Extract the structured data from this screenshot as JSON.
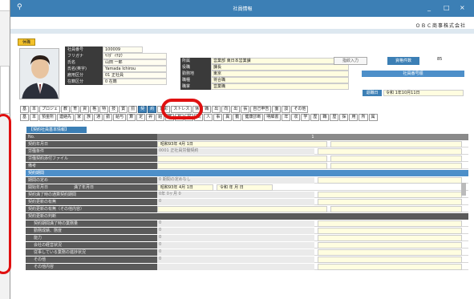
{
  "window": {
    "title": "社員情報",
    "company": "ＯＢＣ商事株式会社",
    "min": "_",
    "max": "□",
    "close": "×"
  },
  "badge": "休職",
  "employee": {
    "fields": [
      {
        "label": "社員番号",
        "value": "100009"
      },
      {
        "label": "フリガナ",
        "value": "ﾔﾏﾀﾞ ｲﾁﾛｳ"
      },
      {
        "label": "氏名",
        "value": "山田 一郎"
      },
      {
        "label": "氏名(英字)",
        "value": "Yamada Ichirou"
      },
      {
        "label": "雇用区分",
        "value": "01 正社員"
      },
      {
        "label": "在籍区分",
        "value": "0 在籍"
      }
    ],
    "org": [
      {
        "label": "所属",
        "value": "営業部 東日本営業課"
      },
      {
        "label": "役職",
        "value": "課長"
      },
      {
        "label": "勤務地",
        "value": "東京"
      },
      {
        "label": "職種",
        "value": "将合職"
      },
      {
        "label": "職掌",
        "value": "営業職"
      }
    ],
    "btn_history": "指紋入力",
    "btn_vacation": "資格件数",
    "count": "85",
    "emp_bar": "社員番号順",
    "retire_label": "退職日",
    "retire_value": "令和 1年10月11日"
  },
  "tabs_row1": [
    "基",
    "本",
    "プロジェ",
    "教",
    "育",
    "資",
    "格",
    "特",
    "技",
    "賞",
    "罰",
    "契",
    "約",
    "表彰",
    "ストレス",
    "休",
    "職",
    "出",
    "向",
    "出",
    "張",
    "自己申告",
    "面",
    "談",
    "その他"
  ],
  "tabs_row2": [
    "基",
    "本",
    "預金所",
    "連絡先",
    "家",
    "族",
    "通",
    "勤",
    "給与",
    "算",
    "定",
    "昇",
    "給",
    "賞",
    "与",
    "届",
    "出",
    "人",
    "事",
    "異",
    "動",
    "健康診断",
    "明細書",
    "年",
    "収",
    "学",
    "歴",
    "職",
    "歴",
    "採",
    "用",
    "所",
    "属"
  ],
  "section_title": "【契約社員基本情報】",
  "rows": [
    {
      "label": "No.",
      "value": "1",
      "type": "header"
    },
    {
      "label": "契約年月日",
      "value": "昭和93年 4月 1日"
    },
    {
      "label": "労働条件",
      "value": "0001 正社員労働契約"
    },
    {
      "label": "労働契約添付ファイル",
      "value": ""
    },
    {
      "label": "備考",
      "value": ""
    },
    {
      "label": "契約期間",
      "value": "",
      "type": "blue"
    },
    {
      "label": "期間の定め",
      "value": "0 期間の定めなし"
    },
    {
      "label": "開始年月日",
      "mid": "満了年月日",
      "value": "昭和93年 4月 1日",
      "value2": "令和 年 月 日"
    },
    {
      "label": "契約満了時の通算契約期間",
      "value": "0年 0ヶ月 0"
    },
    {
      "label": "契約更新の有無",
      "value": "0"
    },
    {
      "label": "契約更新の有無（その他内容）",
      "value": ""
    },
    {
      "label": "契約更新の判断",
      "value": "",
      "type": "group"
    },
    {
      "label": "契約期間満了時の業務量",
      "value": "0",
      "indent": true
    },
    {
      "label": "勤務成績、態度",
      "value": "0",
      "indent": true
    },
    {
      "label": "能力",
      "value": "0",
      "indent": true
    },
    {
      "label": "会社の経営状況",
      "value": "0",
      "indent": true
    },
    {
      "label": "従事している業務の進捗状況",
      "value": "0",
      "indent": true
    },
    {
      "label": "その他",
      "value": "0",
      "indent": true
    },
    {
      "label": "その他内容",
      "value": "",
      "indent": true
    }
  ]
}
